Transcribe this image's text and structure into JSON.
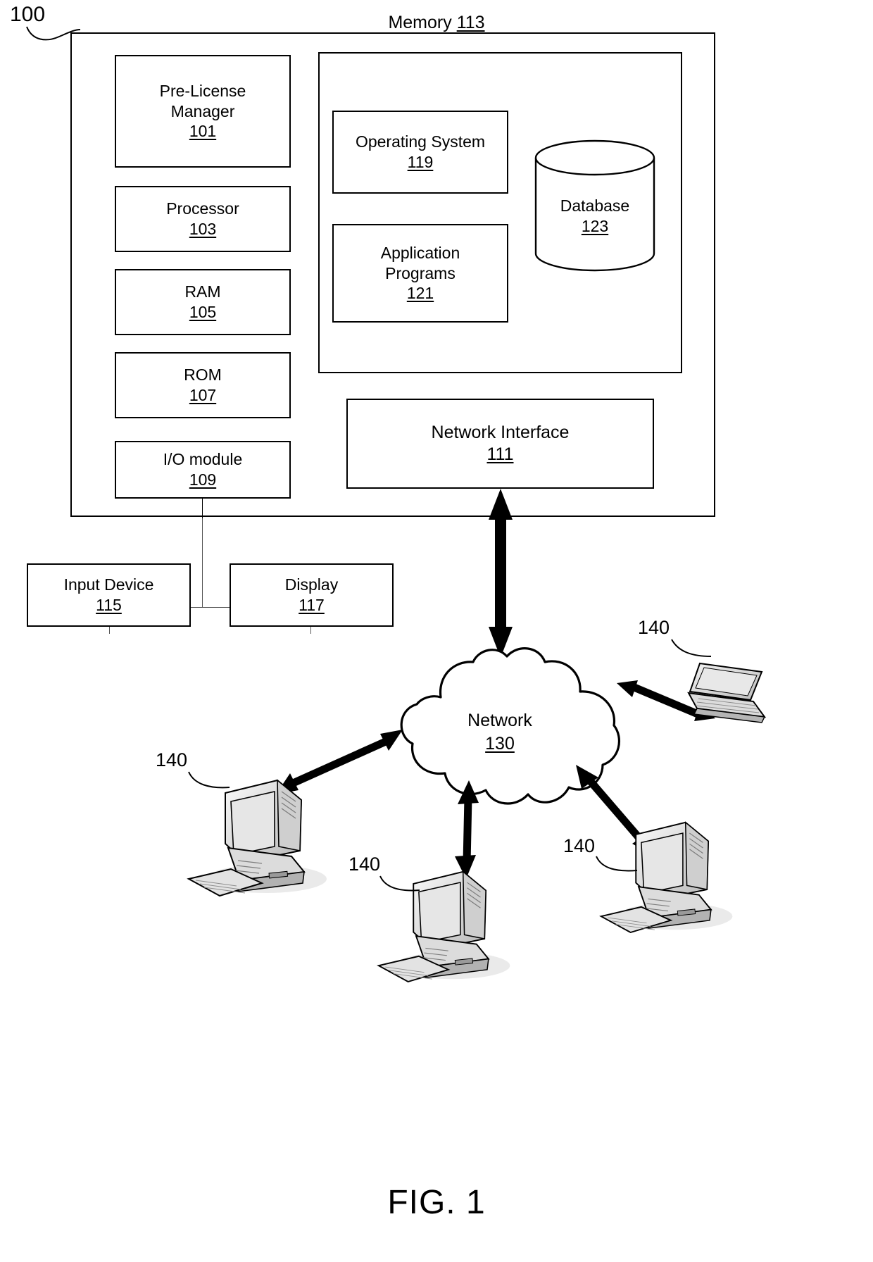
{
  "figure": {
    "caption": "FIG. 1",
    "system_ref": "100"
  },
  "system": {
    "components": [
      {
        "name": "Pre-License Manager",
        "label_line1": "Pre-License",
        "label_line2": "Manager",
        "ref": "101"
      },
      {
        "name": "Processor",
        "label_line1": "Processor",
        "label_line2": "",
        "ref": "103"
      },
      {
        "name": "RAM",
        "label_line1": "RAM",
        "label_line2": "",
        "ref": "105"
      },
      {
        "name": "ROM",
        "label_line1": "ROM",
        "label_line2": "",
        "ref": "107"
      },
      {
        "name": "I/O module",
        "label_line1": "I/O module",
        "label_line2": "",
        "ref": "109"
      }
    ],
    "memory": {
      "title": "Memory",
      "ref": "113",
      "items": [
        {
          "label_line1": "Operating System",
          "label_line2": "",
          "ref": "119"
        },
        {
          "label_line1": "Application",
          "label_line2": "Programs",
          "ref": "121"
        }
      ],
      "database": {
        "label": "Database",
        "ref": "123"
      }
    },
    "network_interface": {
      "label": "Network Interface",
      "ref": "111"
    }
  },
  "peripherals": [
    {
      "label": "Input Device",
      "ref": "115"
    },
    {
      "label": "Display",
      "ref": "117"
    }
  ],
  "network": {
    "label": "Network",
    "ref": "130"
  },
  "terminals": [
    {
      "ref": "140",
      "kind": "laptop",
      "position": "top-right"
    },
    {
      "ref": "140",
      "kind": "desktop-computer",
      "position": "left"
    },
    {
      "ref": "140",
      "kind": "desktop-computer",
      "position": "bottom-center"
    },
    {
      "ref": "140",
      "kind": "desktop-computer",
      "position": "bottom-right"
    }
  ],
  "colors": {
    "stroke": "#000000",
    "background": "#ffffff",
    "shade": "#c9c9c9"
  }
}
